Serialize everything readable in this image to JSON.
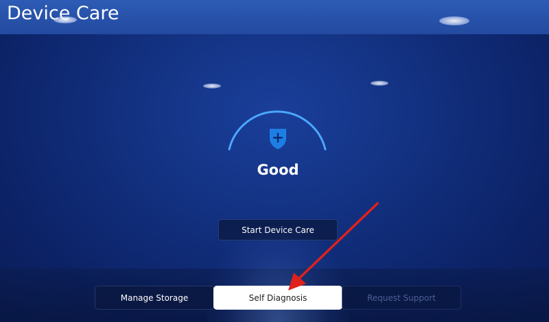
{
  "app": {
    "title": "Device Care"
  },
  "status": {
    "label": "Good",
    "icon": "shield-plus-icon"
  },
  "actions": {
    "start_label": "Start Device Care"
  },
  "tabs": [
    {
      "label": "Manage Storage",
      "selected": false,
      "enabled": true
    },
    {
      "label": "Self Diagnosis",
      "selected": true,
      "enabled": true
    },
    {
      "label": "Request Support",
      "selected": false,
      "enabled": false
    }
  ],
  "annotation": {
    "arrow_color": "#e0211b"
  },
  "colors": {
    "background": "#12307f",
    "accent_arc": "#4aa8ff",
    "shield": "#1d7fe6"
  }
}
